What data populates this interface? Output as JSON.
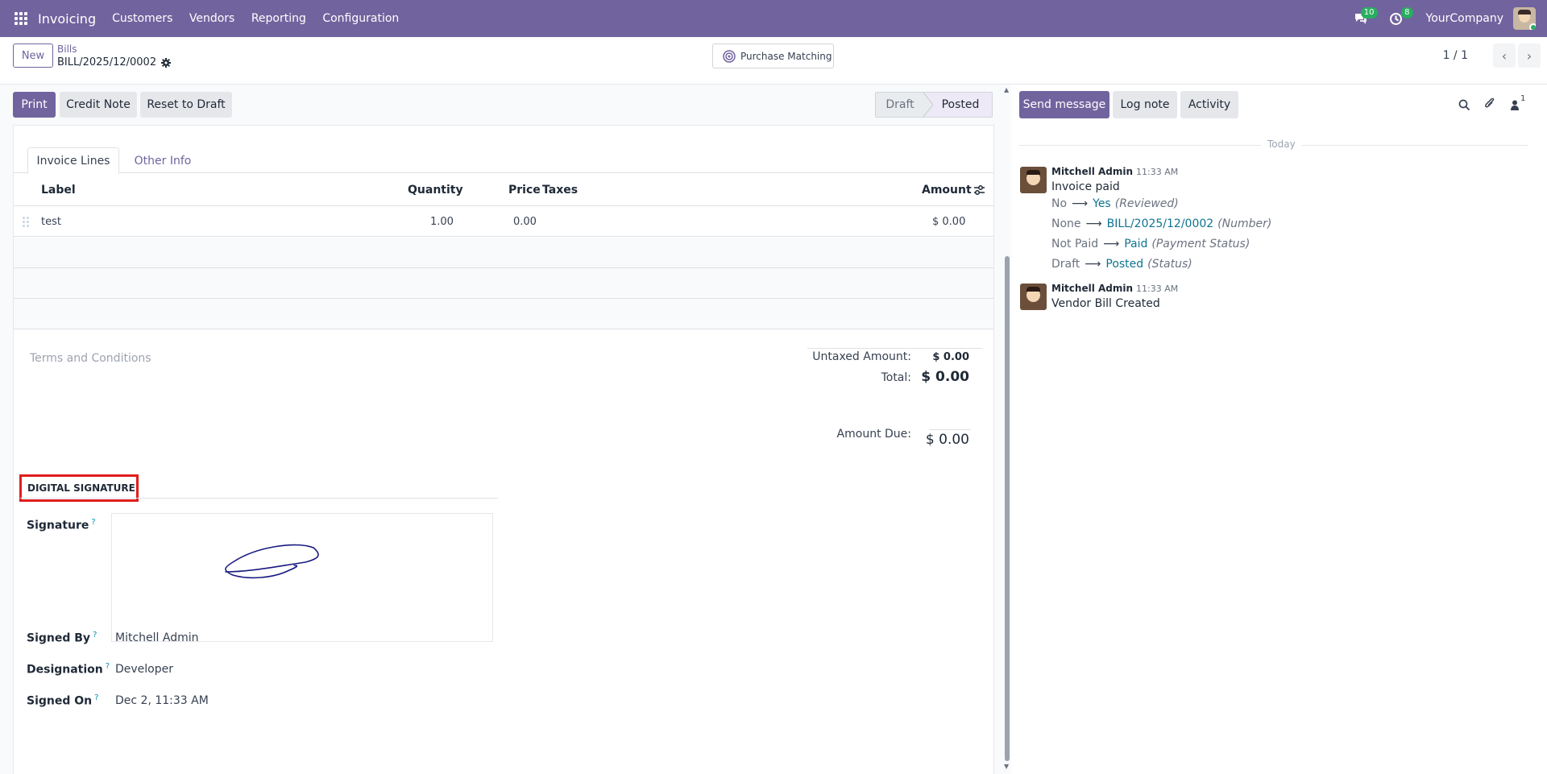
{
  "navbar": {
    "app_name": "Invoicing",
    "menu": [
      "Customers",
      "Vendors",
      "Reporting",
      "Configuration"
    ],
    "messages_count": "10",
    "activities_count": "8",
    "company": "YourCompany"
  },
  "control_panel": {
    "new_label": "New",
    "breadcrumb_parent": "Bills",
    "breadcrumb_current": "BILL/2025/12/0002",
    "purchase_matching_label": "Purchase Matching",
    "pager": "1 / 1"
  },
  "actions": {
    "print": "Print",
    "credit_note": "Credit Note",
    "reset_to_draft": "Reset to Draft"
  },
  "statusbar": {
    "stages": [
      "Draft",
      "Posted"
    ],
    "current": "Posted"
  },
  "tabs": [
    "Invoice Lines",
    "Other Info"
  ],
  "invoice_lines": {
    "columns": [
      "Label",
      "Quantity",
      "Price",
      "Taxes",
      "Amount"
    ],
    "rows": [
      {
        "label": "test",
        "quantity": "1.00",
        "price": "0.00",
        "taxes": "",
        "amount": "$ 0.00"
      }
    ]
  },
  "terms_placeholder": "Terms and Conditions",
  "totals": {
    "untaxed_label": "Untaxed Amount:",
    "untaxed_value": "$ 0.00",
    "total_label": "Total:",
    "total_value": "$ 0.00",
    "amount_due_label": "Amount Due:",
    "amount_due_value": "$ 0.00"
  },
  "digital_signature": {
    "section_title": "DIGITAL SIGNATURE",
    "signature_label": "Signature",
    "signed_by_label": "Signed By",
    "signed_by_value": "Mitchell Admin",
    "designation_label": "Designation",
    "designation_value": "Developer",
    "signed_on_label": "Signed On",
    "signed_on_value": "Dec 2, 11:33 AM",
    "help_mark": "?"
  },
  "chatter": {
    "send_message": "Send message",
    "log_note": "Log note",
    "activity": "Activity",
    "followers_count": "1",
    "date_separator": "Today",
    "messages": [
      {
        "author": "Mitchell Admin",
        "time": "11:33 AM",
        "body": "Invoice paid",
        "changes": [
          {
            "old": "No",
            "new": "Yes",
            "field": "(Reviewed)"
          },
          {
            "old": "None",
            "new": "BILL/2025/12/0002",
            "field": "(Number)"
          },
          {
            "old": "Not Paid",
            "new": "Paid",
            "field": "(Payment Status)"
          },
          {
            "old": "Draft",
            "new": "Posted",
            "field": "(Status)"
          }
        ]
      },
      {
        "author": "Mitchell Admin",
        "time": "11:33 AM",
        "body": "Vendor Bill Created"
      }
    ]
  },
  "colors": {
    "brand": "#71639e",
    "highlight_border": "#e11d1d",
    "badge_green": "#27ae60",
    "link": "#0e7490"
  }
}
